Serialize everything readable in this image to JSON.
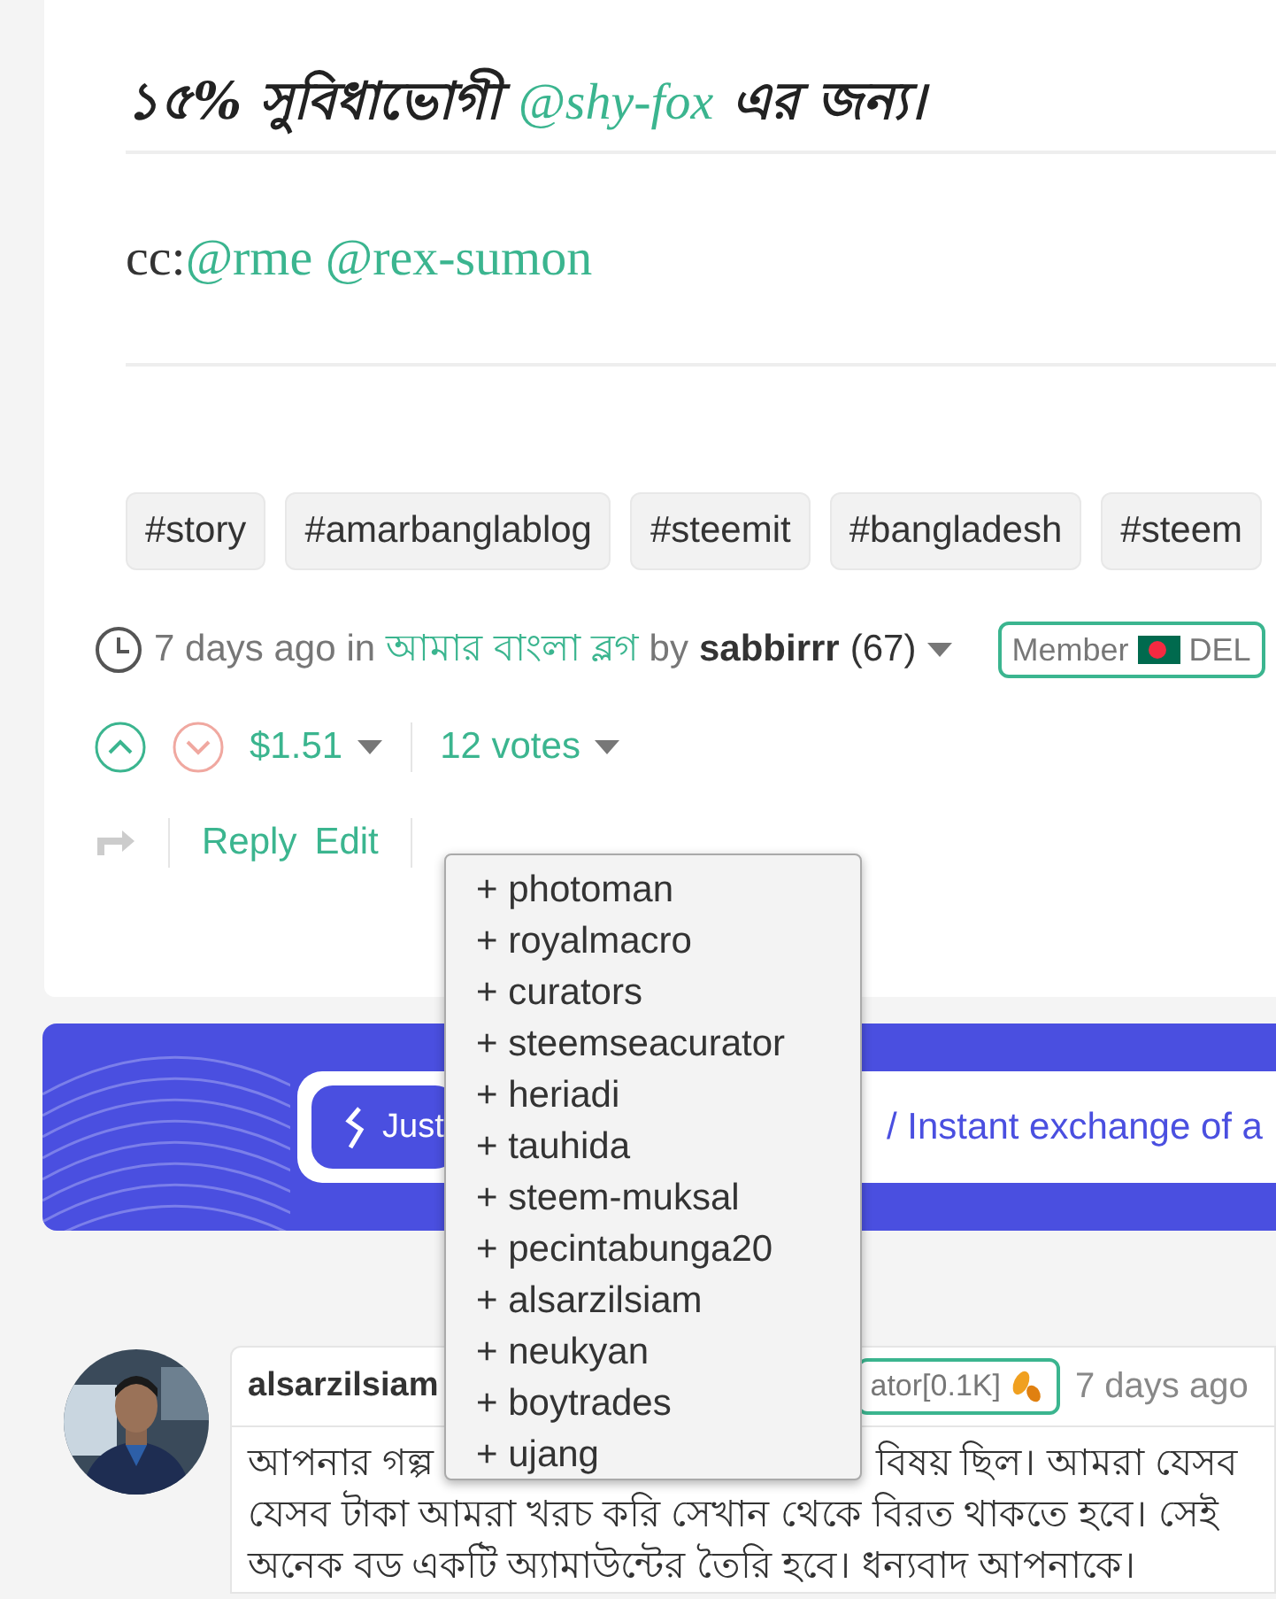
{
  "post": {
    "heading": {
      "before": "১৫% সুবিধাভোগী",
      "mention": "@shy-fox",
      "after": "এর জন্য।"
    },
    "cc": {
      "prefix": "cc:",
      "mentions": [
        "@rme",
        "@rex-sumon"
      ]
    },
    "tags": [
      "#story",
      "#amarbanglablog",
      "#steemit",
      "#bangladesh",
      "#steem"
    ],
    "meta": {
      "time": "7 days ago",
      "in": "in",
      "community": "আমার বাংলা ব্লগ",
      "by": "by",
      "author": "sabbirrr",
      "reputation": "(67)",
      "badge": {
        "label": "Member",
        "suffix": "DEL"
      }
    },
    "payout": "$1.51",
    "votes": "12 votes",
    "actions": [
      "Reply",
      "Edit"
    ]
  },
  "voters": [
    "+ photoman",
    "+ royalmacro",
    "+ curators",
    "+ steemseacurator",
    "+ heriadi",
    "+ tauhida",
    "+ steem-muksal",
    "+ pecintabunga20",
    "+ alsarzilsiam",
    "+ neukyan",
    "+ boytrades",
    "+ ujang"
  ],
  "banner": {
    "button": "Just",
    "text": "/ Instant exchange of a"
  },
  "comment": {
    "author": "alsarzilsiam",
    "badge": "ator[0.1K]",
    "time": "7 days ago",
    "lines": [
      {
        "left": "আপনার গল্প",
        "right": "বিষয় ছিল। আমরা যেসব"
      },
      {
        "text": "যেসব টাকা আমরা খরচ করি সেখান থেকে বিরত থাকতে হবে। সেই"
      },
      {
        "text": "অনেক বড একটি অ্যামাউন্টের তৈরি হবে। ধন্যবাদ আপনাকে।"
      }
    ]
  }
}
